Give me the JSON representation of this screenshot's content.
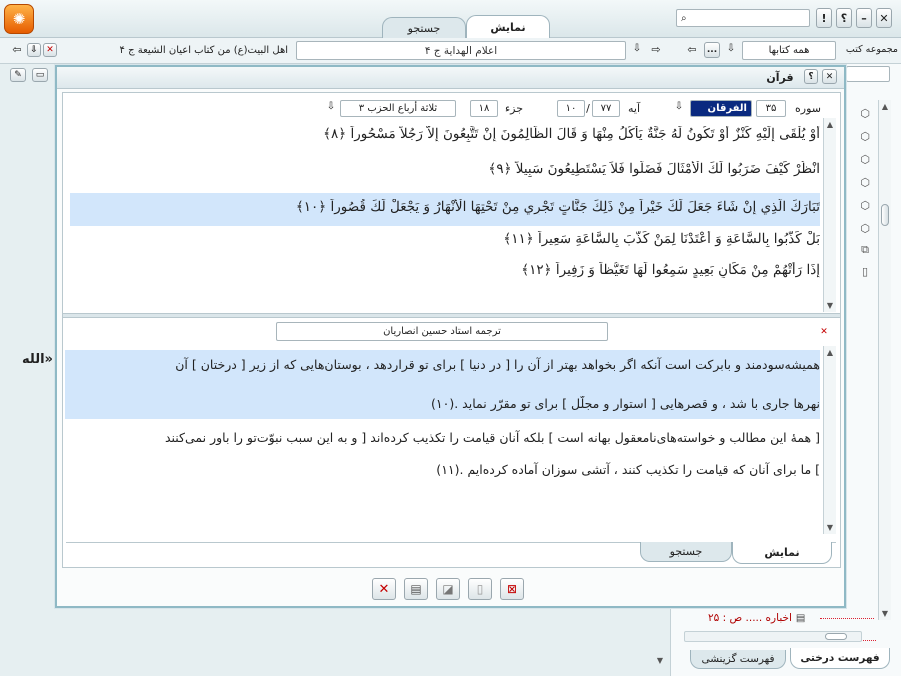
{
  "app": {
    "top_tabs": {
      "show": "نمایش",
      "search": "جستجو"
    },
    "help_label": "؟",
    "sort_label": "!"
  },
  "nav": {
    "book_right": "اعلام الهدایة ج ۴",
    "book_left": "اهل البیت(ع) من کتاب اعیان الشیعة ج ۴",
    "collection_label": "مجموعه کتب",
    "collection_value": "همه کتابها",
    "more": "..."
  },
  "quran_window": {
    "title": "قرآن",
    "surah_label": "سوره",
    "surah_number": "۳۵",
    "surah_name": "الفرقان",
    "ayah_label": "آیه",
    "ayah_total": "۷۷",
    "ayah_current": "۱۰",
    "juz_label": "جزء",
    "juz_value": "۱۸",
    "hizb_value": "ثلاثة أرباع الحزب ۳",
    "ayat": [
      "أَوْ يُلْقَى إِلَيْهِ كَنْزٌ أَوْ تَكُونُ لَهُ جَنَّةٌ يَأْكُلُ مِنْهَا وَ قَالَ الظَّالِمُونَ إِنْ تَتَّبِعُونَ إِلاَّ رَجُلاً مَسْحُوراً ﴿۸﴾",
      "انْظُرْ كَيْفَ ضَرَبُوا لَكَ الْأَمْثَالَ فَضَلُّوا فَلاَ يَسْتَطِيعُونَ سَبِيلاً ﴿۹﴾",
      "تَبَارَكَ الَّذِي إِنْ شَاءَ جَعَلَ لَكَ خَيْراً مِنْ ذَلِكَ جَنَّاتٍ تَجْرِي مِنْ تَحْتِهَا الْأَنْهَارُ وَ يَجْعَلْ لَكَ قُصُوراً ﴿۱۰﴾",
      "بَلْ كَذَّبُوا بِالسَّاعَةِ وَ أَعْتَدْنَا لِمَنْ كَذَّبَ بِالسَّاعَةِ سَعِيراً ﴿۱۱﴾",
      "إِذَا رَأَتْهُمْ مِنْ مَكَانٍ بَعِيدٍ سَمِعُوا لَهَا تَغَيُّظاً وَ زَفِيراً ﴿۱۲﴾"
    ],
    "translator": "ترجمه استاد حسین انصاریان",
    "translation_lines": [
      "همیشه‌سودمند و بابرکت است آنکه اگر بخواهد بهتر از آن را [ در دنیا ] برای تو قرار‌دهد ، بوستان‌هایی که از زیرِ [ درختانِ ] آن",
      "نهرها جاری با شد ، و قصرهایی [ استوار و مجلّل ] برای تو مقرّر نماید .(۱۰)",
      "[ همهٔ این مطالب و خواسته‌های‌نامعقول بهانه است ] بلکه آنان قیامت را تکذیب کرده‌اند [ و به این سبب نبوّت‌تو را باور نمی‌کنند",
      "] ما برای آنان که قیامت را تکذیب کنند ، آتشی سوزان آماده کرده‌ایم .(۱۱)"
    ],
    "bottom_tabs": {
      "show": "نمایش",
      "search": "جستجو"
    }
  },
  "background": {
    "fragment_text": "الله»",
    "tree_item": "اخباره ..... ص : ۲۵",
    "bottom_tabs": {
      "tree": "فهرست درختی",
      "selected": "فهرست گزینشی"
    }
  }
}
